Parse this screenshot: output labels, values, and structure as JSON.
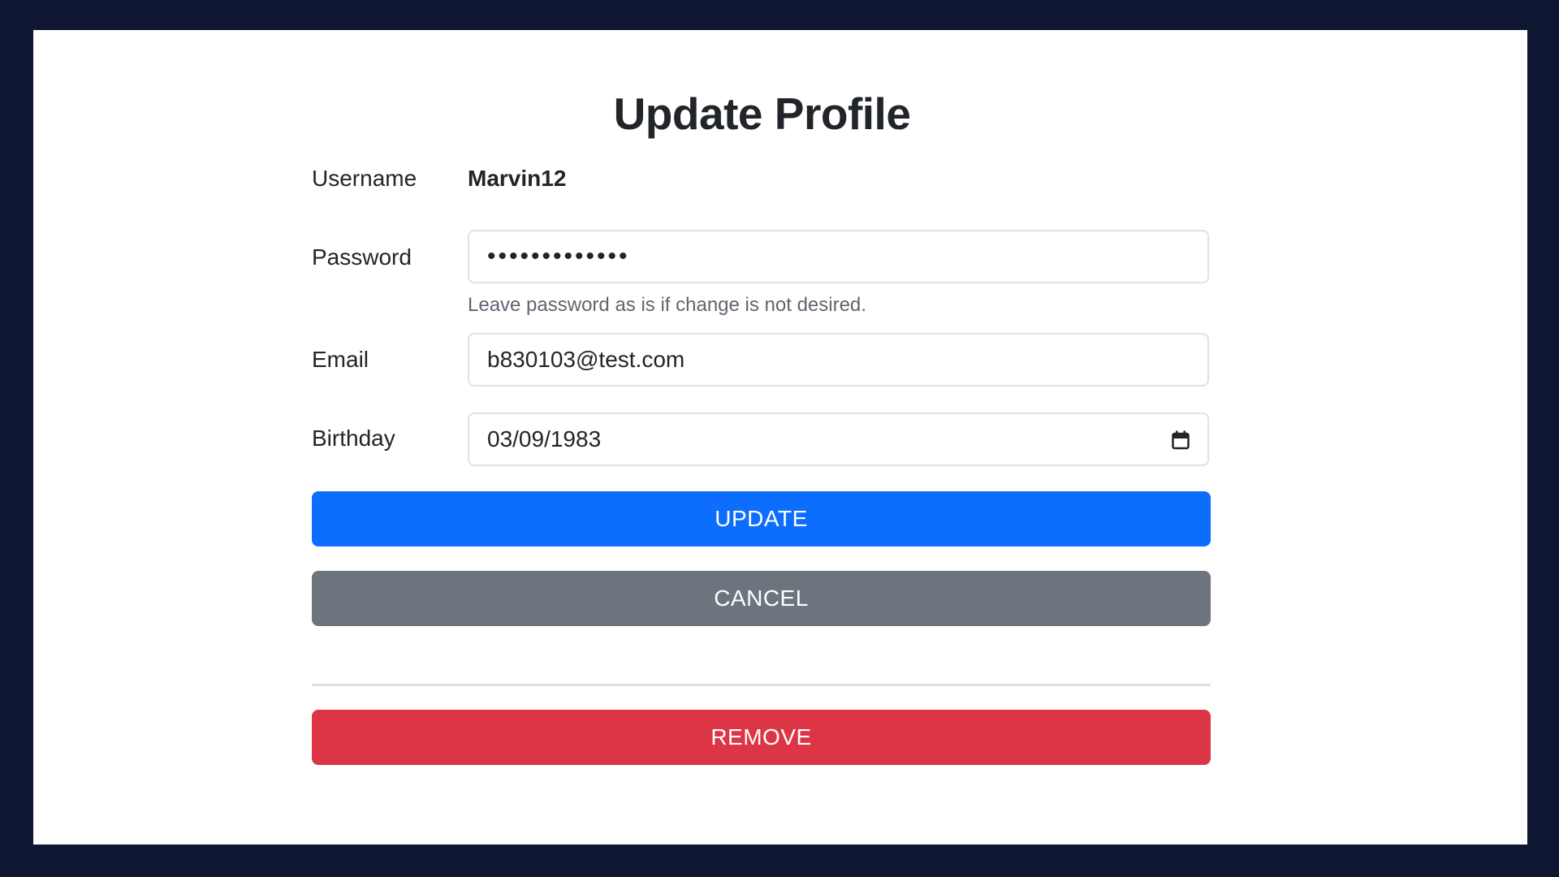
{
  "page": {
    "title": "Update Profile"
  },
  "form": {
    "username_label": "Username",
    "username_value": "Marvin12",
    "password_label": "Password",
    "password_value": "•••••••••••••",
    "password_help": "Leave password as is if change is not desired.",
    "email_label": "Email",
    "email_value": "b830103@test.com",
    "birthday_label": "Birthday",
    "birthday_value": "03/09/1983",
    "birthday_icon": "calendar-icon"
  },
  "actions": {
    "update_label": "UPDATE",
    "cancel_label": "CANCEL",
    "remove_label": "REMOVE"
  },
  "colors": {
    "background": "#0e1631",
    "primary": "#0d6efd",
    "secondary": "#6c757d",
    "danger": "#dc3545"
  }
}
